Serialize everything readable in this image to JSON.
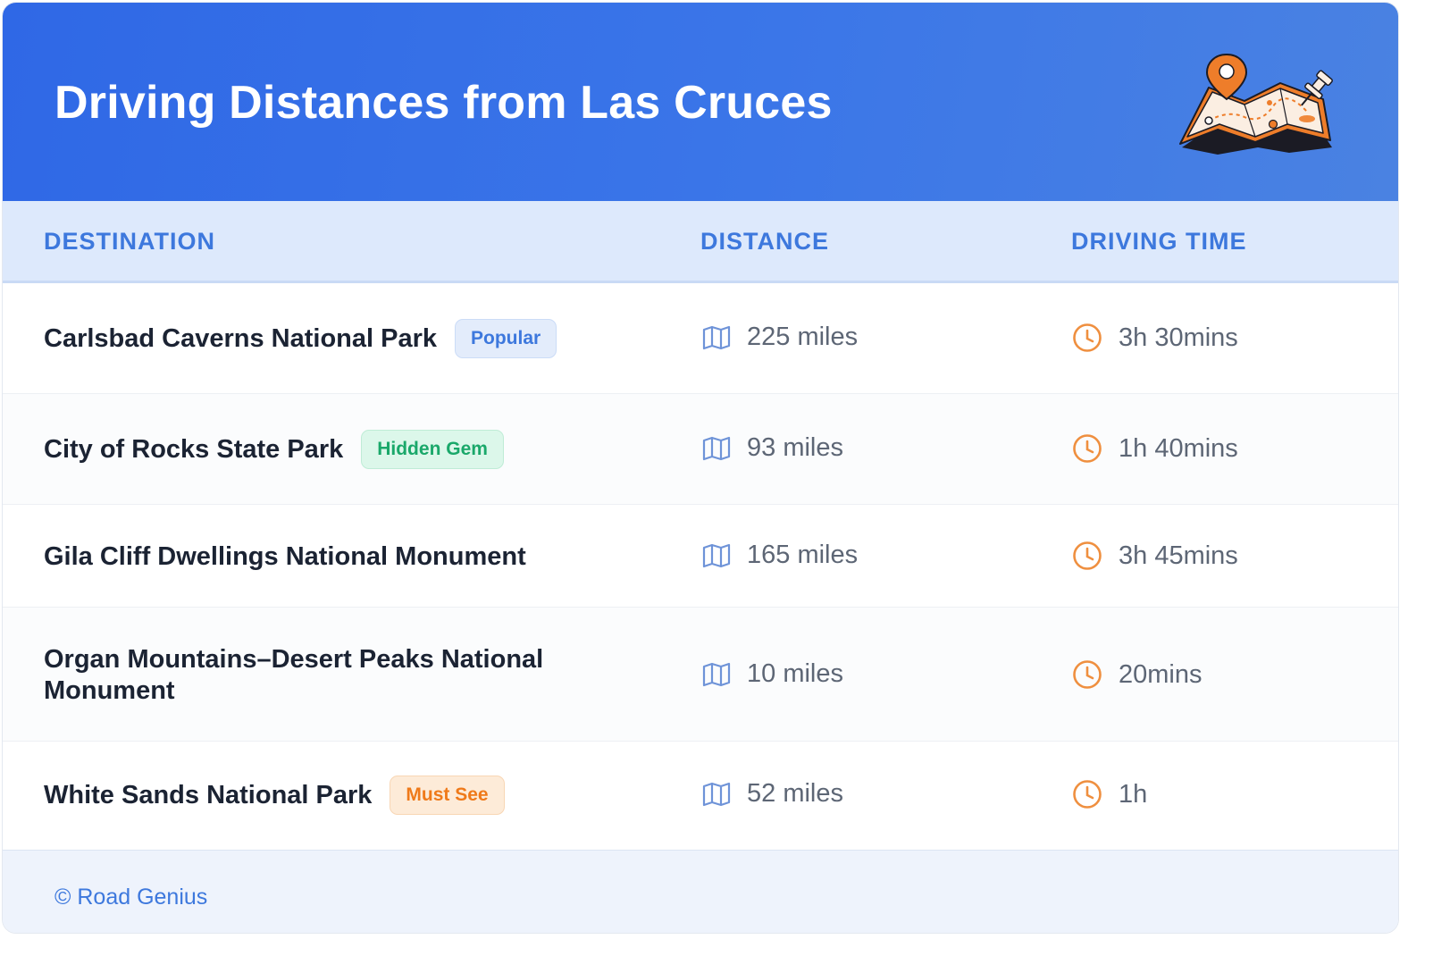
{
  "header": {
    "title": "Driving Distances from Las Cruces",
    "illustration_icon": "map-with-pins-icon"
  },
  "table": {
    "columns": [
      "DESTINATION",
      "DISTANCE",
      "DRIVING TIME"
    ],
    "rows": [
      {
        "destination": "Carlsbad Caverns National Park",
        "badge": "Popular",
        "distance": "225 miles",
        "time": "3h 30mins"
      },
      {
        "destination": "City of Rocks State Park",
        "badge": "Hidden Gem",
        "distance": "93 miles",
        "time": "1h 40mins"
      },
      {
        "destination": "Gila Cliff Dwellings National Monument",
        "badge": "",
        "distance": "165 miles",
        "time": "3h 45mins"
      },
      {
        "destination": "Organ Mountains–Desert Peaks National Monument",
        "badge": "",
        "distance": "10 miles",
        "time": "20mins"
      },
      {
        "destination": "White Sands National Park",
        "badge": "Must See",
        "distance": "52 miles",
        "time": "1h"
      }
    ],
    "distance_icon": "map-icon",
    "time_icon": "clock-icon"
  },
  "footer": {
    "copyright": "© Road Genius"
  },
  "colors": {
    "header_blue": "#2f68e6",
    "accent_blue": "#3d78dd",
    "orange": "#ef7a1a",
    "green": "#1aa86a"
  }
}
